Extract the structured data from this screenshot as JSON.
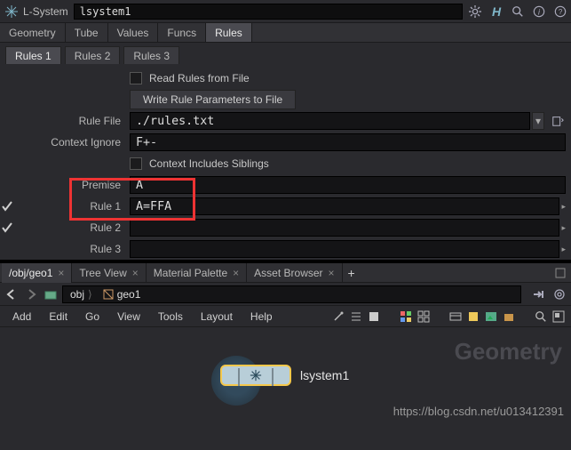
{
  "titlebar": {
    "app_label": "L-System",
    "node_name": "lsystem1"
  },
  "maintabs": [
    "Geometry",
    "Tube",
    "Values",
    "Funcs",
    "Rules"
  ],
  "maintab_active": 4,
  "subtabs": [
    "Rules 1",
    "Rules 2",
    "Rules 3"
  ],
  "subtab_active": 0,
  "form": {
    "read_rules_label": "Read Rules from File",
    "write_rules_btn": "Write Rule Parameters to File",
    "rule_file_label": "Rule File",
    "rule_file_value": "./rules.txt",
    "context_ignore_label": "Context Ignore",
    "context_ignore_value": "F+-",
    "context_includes_label": "Context Includes Siblings",
    "premise_label": "Premise",
    "premise_value": "A",
    "rule1_label": "Rule 1",
    "rule1_value": "A=FFA",
    "rule2_label": "Rule 2",
    "rule2_value": "",
    "rule3_label": "Rule 3",
    "rule3_value": ""
  },
  "lower_tabs": [
    {
      "crumb": "/obj/geo1"
    },
    {
      "label": "Tree View"
    },
    {
      "label": "Material Palette"
    },
    {
      "label": "Asset Browser"
    }
  ],
  "path": {
    "seg1": "obj",
    "seg2": "geo1"
  },
  "menu": [
    "Add",
    "Edit",
    "Go",
    "View",
    "Tools",
    "Layout",
    "Help"
  ],
  "canvas": {
    "context_label": "Geometry",
    "node_label": "lsystem1"
  },
  "watermark": "https://blog.csdn.net/u013412391"
}
